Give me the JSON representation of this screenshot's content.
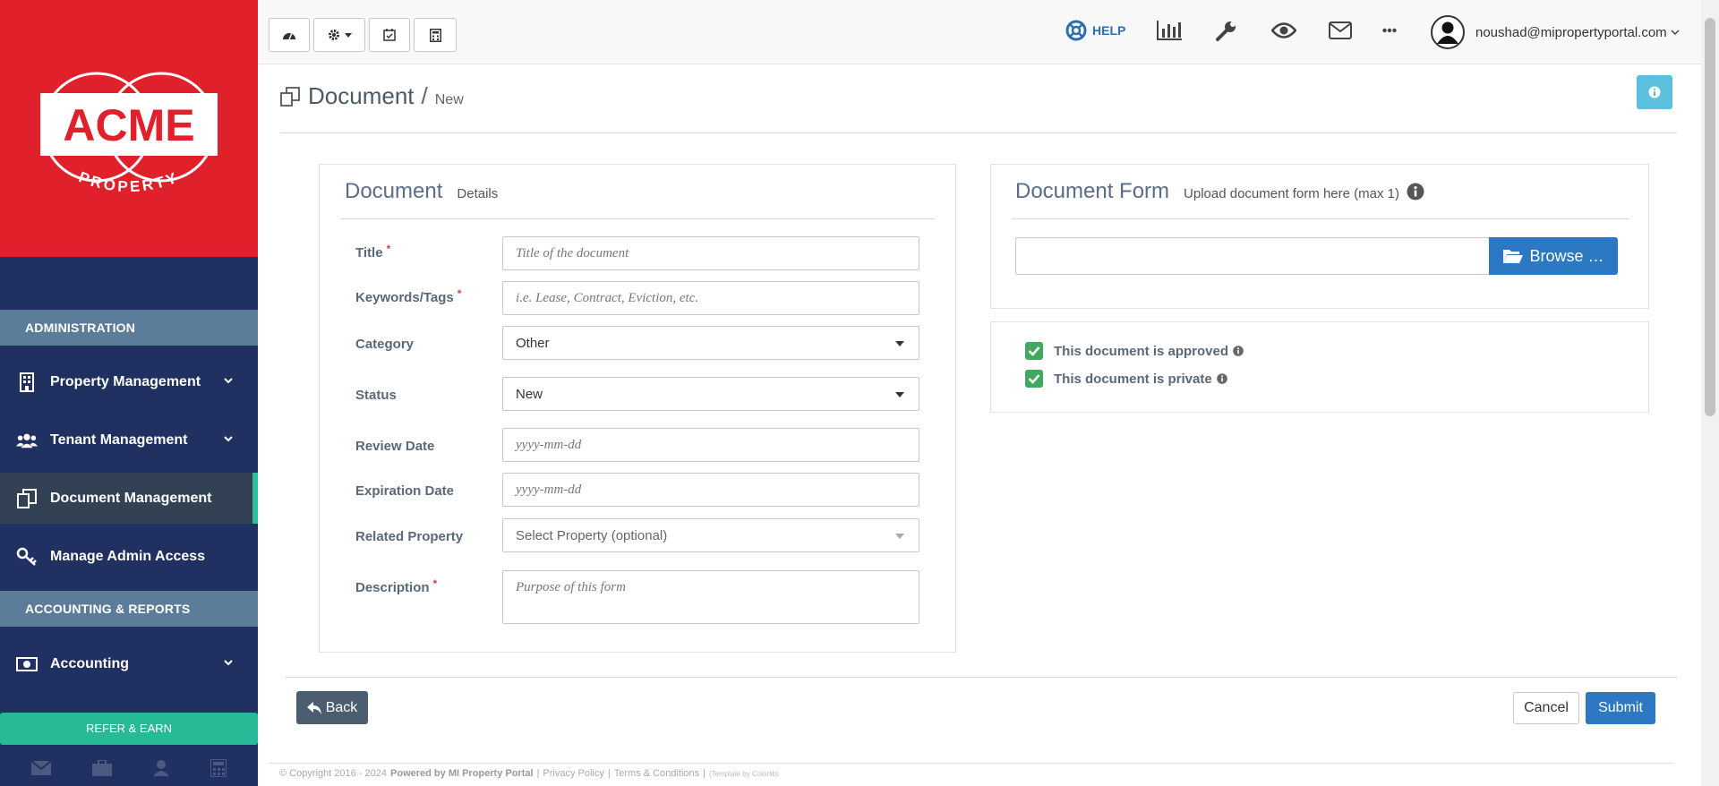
{
  "brand": {
    "logo_text": "ACME",
    "logo_subtext": "PROPERTY",
    "primary_color": "#e0202b",
    "sidebar_color": "#203061",
    "accent_color": "#26bb96"
  },
  "sidebar": {
    "sections": [
      {
        "heading": "ADMINISTRATION",
        "items": [
          {
            "label": "Property Management",
            "icon": "building-icon",
            "has_submenu": true
          },
          {
            "label": "Tenant Management",
            "icon": "users-icon",
            "has_submenu": true
          },
          {
            "label": "Document Management",
            "icon": "documents-icon",
            "active": true
          },
          {
            "label": "Manage Admin Access",
            "icon": "key-icon"
          }
        ]
      },
      {
        "heading": "ACCOUNTING & REPORTS",
        "items": [
          {
            "label": "Accounting",
            "icon": "money-icon",
            "has_submenu": true
          }
        ]
      }
    ],
    "refer_label": "REFER & EARN",
    "bottom_icons": [
      "envelope-icon",
      "briefcase-icon",
      "user-icon",
      "calculator-icon"
    ]
  },
  "topbar": {
    "left_buttons": [
      "dashboard-icon",
      "settings-icon",
      "calendar-icon",
      "calculator-icon"
    ],
    "help_label": "HELP",
    "right_icons": [
      "bar-chart-icon",
      "wrench-icon",
      "eye-icon",
      "envelope-icon",
      "more-icon"
    ],
    "user_email": "noushad@mipropertyportal.com"
  },
  "page": {
    "title": "Document",
    "subtitle": "New"
  },
  "details_panel": {
    "title": "Document",
    "subtitle": "Details",
    "fields": {
      "title": {
        "label": "Title",
        "placeholder": "Title of the document",
        "required": true
      },
      "keywords": {
        "label": "Keywords/Tags",
        "placeholder": "i.e. Lease, Contract, Eviction, etc.",
        "required": true
      },
      "category": {
        "label": "Category",
        "value": "Other"
      },
      "status": {
        "label": "Status",
        "value": "New"
      },
      "review_date": {
        "label": "Review Date",
        "placeholder": "yyyy-mm-dd"
      },
      "expiration_date": {
        "label": "Expiration Date",
        "placeholder": "yyyy-mm-dd"
      },
      "related_property": {
        "label": "Related Property",
        "placeholder": "Select Property (optional)"
      },
      "description": {
        "label": "Description",
        "placeholder": "Purpose of this form",
        "required": true
      }
    }
  },
  "form_panel": {
    "title": "Document Form",
    "subtitle": "Upload document form here (max 1)",
    "browse_label": "Browse …"
  },
  "options_panel": {
    "approved_label": "This document is approved",
    "private_label": "This document is private",
    "approved_checked": true,
    "private_checked": true
  },
  "actions": {
    "back_label": "Back",
    "cancel_label": "Cancel",
    "submit_label": "Submit"
  },
  "footer": {
    "copyright": "© Copyright 2016 - 2024",
    "powered": "Powered by MI Property Portal",
    "privacy": "Privacy Policy",
    "terms": "Terms & Conditions",
    "template": "(Template by Colorlib)"
  }
}
